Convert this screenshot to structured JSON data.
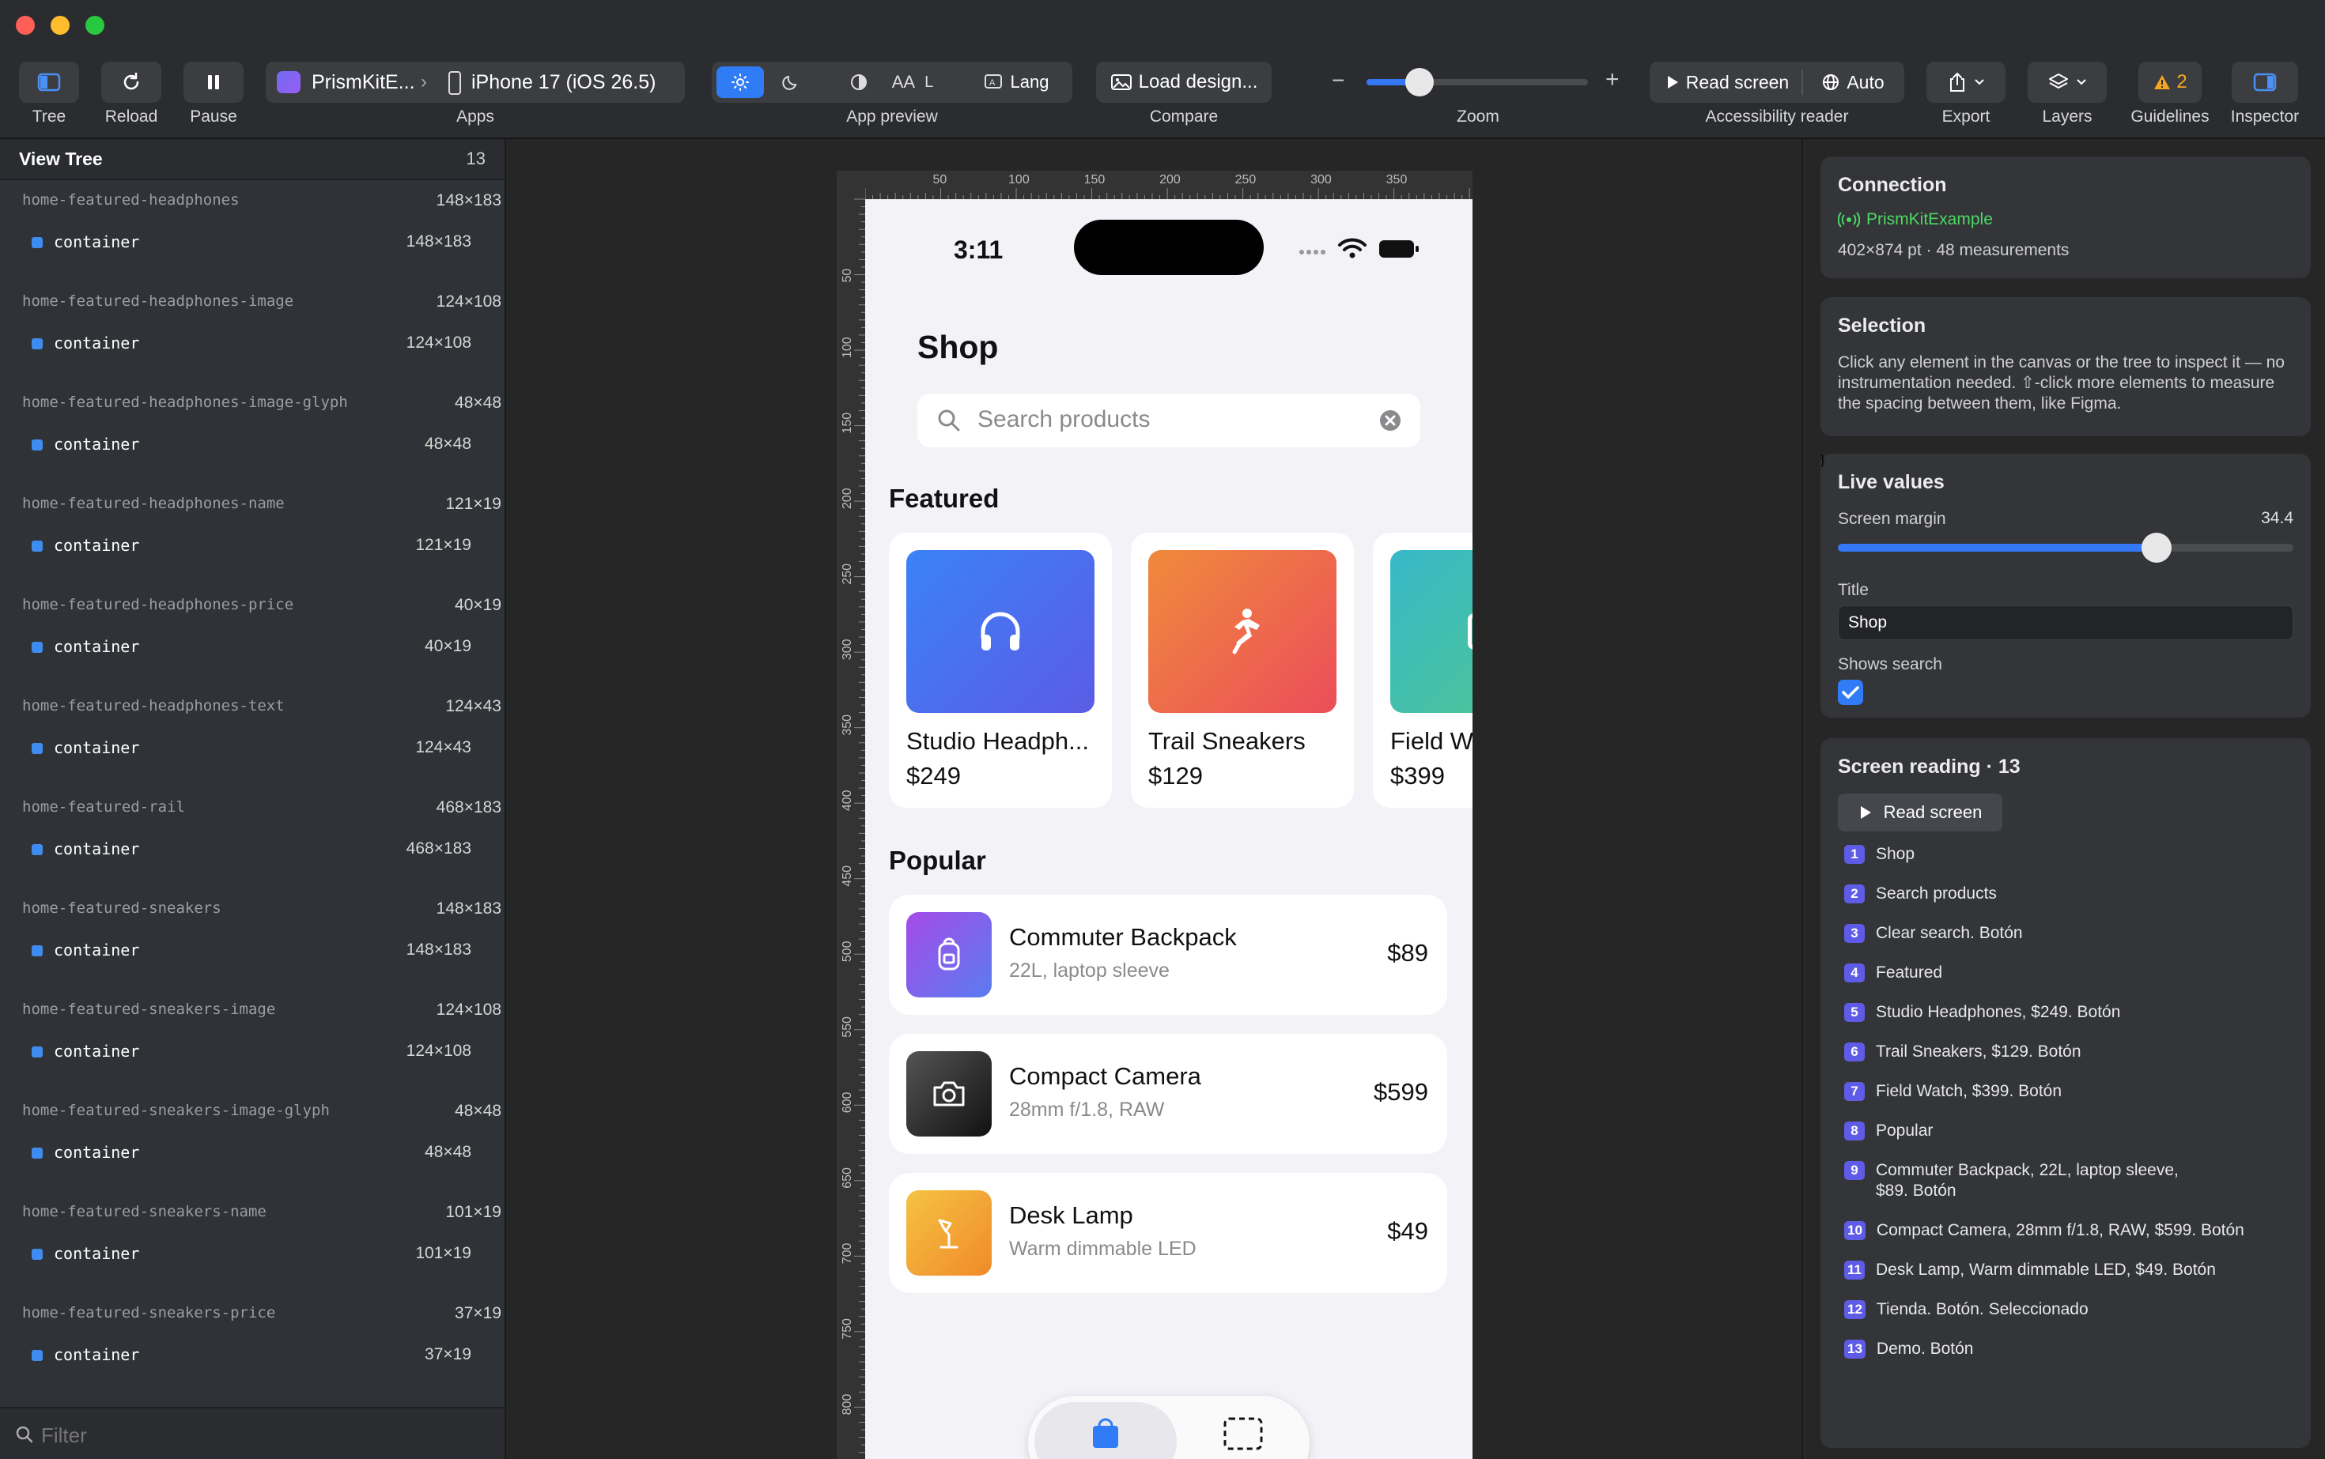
{
  "toolbar": {
    "tree": "Tree",
    "reload": "Reload",
    "pause": "Pause",
    "app_name": "PrismKitE...",
    "device": "iPhone 17 (iOS 26.5)",
    "apps": "Apps",
    "text_size": "AA",
    "text_size_level": "L",
    "lang": "Lang",
    "app_preview": "App preview",
    "load_design": "Load design...",
    "compare": "Compare",
    "zoom_minus": "−",
    "zoom_plus": "+",
    "zoom": "Zoom",
    "zoom_level": 0.24,
    "read_screen": "Read screen",
    "auto": "Auto",
    "accessibility_reader": "Accessibility reader",
    "export": "Export",
    "layers": "Layers",
    "guidelines_count": "2",
    "guidelines": "Guidelines",
    "inspector": "Inspector"
  },
  "view_tree": {
    "title": "View Tree",
    "count": "13",
    "filter_placeholder": "Filter",
    "items": [
      {
        "name": "home-featured-headphones",
        "size": "148×183",
        "kind": "container",
        "kind_size": "148×183"
      },
      {
        "name": "home-featured-headphones-image",
        "size": "124×108",
        "kind": "container",
        "kind_size": "124×108"
      },
      {
        "name": "home-featured-headphones-image-glyph",
        "size": "48×48",
        "kind": "container",
        "kind_size": "48×48"
      },
      {
        "name": "home-featured-headphones-name",
        "size": "121×19",
        "kind": "container",
        "kind_size": "121×19"
      },
      {
        "name": "home-featured-headphones-price",
        "size": "40×19",
        "kind": "container",
        "kind_size": "40×19"
      },
      {
        "name": "home-featured-headphones-text",
        "size": "124×43",
        "kind": "container",
        "kind_size": "124×43"
      },
      {
        "name": "home-featured-rail",
        "size": "468×183",
        "kind": "container",
        "kind_size": "468×183"
      },
      {
        "name": "home-featured-sneakers",
        "size": "148×183",
        "kind": "container",
        "kind_size": "148×183"
      },
      {
        "name": "home-featured-sneakers-image",
        "size": "124×108",
        "kind": "container",
        "kind_size": "124×108"
      },
      {
        "name": "home-featured-sneakers-image-glyph",
        "size": "48×48",
        "kind": "container",
        "kind_size": "48×48"
      },
      {
        "name": "home-featured-sneakers-name",
        "size": "101×19",
        "kind": "container",
        "kind_size": "101×19"
      },
      {
        "name": "home-featured-sneakers-price",
        "size": "37×19",
        "kind": "container",
        "kind_size": "37×19"
      }
    ]
  },
  "ruler": {
    "top": [
      "50",
      "100",
      "150",
      "200",
      "250",
      "300",
      "350"
    ],
    "left": [
      "50",
      "100",
      "150",
      "200",
      "250",
      "300",
      "350",
      "400",
      "450",
      "500",
      "550",
      "600",
      "650",
      "700",
      "750",
      "800"
    ]
  },
  "phone": {
    "time": "3:11",
    "title": "Shop",
    "search_placeholder": "Search products",
    "featured_heading": "Featured",
    "featured": [
      {
        "name": "Studio Headph...",
        "price": "$249",
        "color_from": "#3b82f6",
        "color_to": "#5b5ce6"
      },
      {
        "name": "Trail Sneakers",
        "price": "$129",
        "color_from": "#f08a3c",
        "color_to": "#ec4d5a"
      },
      {
        "name": "Field W",
        "price": "$399",
        "color_from": "#37b8c8",
        "color_to": "#52c88c"
      }
    ],
    "popular_heading": "Popular",
    "popular": [
      {
        "name": "Commuter Backpack",
        "subtitle": "22L, laptop sleeve",
        "price": "$89"
      },
      {
        "name": "Compact Camera",
        "subtitle": "28mm f/1.8, RAW",
        "price": "$599"
      },
      {
        "name": "Desk Lamp",
        "subtitle": "Warm dimmable LED",
        "price": "$49"
      }
    ]
  },
  "inspector": {
    "connection_title": "Connection",
    "connection_app": "PrismKitExample",
    "connection_info": "402×874 pt · 48 measurements",
    "selection_title": "Selection",
    "selection_text": "Click any element in the canvas or the tree to inspect it — no instrumentation needed. ⇧-click more elements to measure the spacing between them, like Figma.",
    "live_values_title": "Live values",
    "screen_margin_label": "Screen margin",
    "screen_margin_value": "34.4",
    "screen_margin_fraction": 0.7,
    "title_label": "Title",
    "title_value": "Shop",
    "shows_search_label": "Shows search",
    "shows_search_checked": true,
    "screen_reading_title": "Screen reading · 13",
    "read_screen_button": "Read screen",
    "readings": [
      {
        "n": "1",
        "text": "Shop"
      },
      {
        "n": "2",
        "text": "Search products"
      },
      {
        "n": "3",
        "text": "Clear search. Botón"
      },
      {
        "n": "4",
        "text": "Featured"
      },
      {
        "n": "5",
        "text": "Studio Headphones, $249. Botón"
      },
      {
        "n": "6",
        "text": "Trail Sneakers, $129. Botón"
      },
      {
        "n": "7",
        "text": "Field Watch, $399. Botón"
      },
      {
        "n": "8",
        "text": "Popular"
      },
      {
        "n": "9",
        "text": "Commuter Backpack, 22L, laptop sleeve,",
        "text2": "$89. Botón"
      },
      {
        "n": "10",
        "text": "Compact Camera, 28mm f/1.8, RAW, $599. Botón"
      },
      {
        "n": "11",
        "text": "Desk Lamp, Warm dimmable LED, $49. Botón"
      },
      {
        "n": "12",
        "text": "Tienda. Botón. Seleccionado"
      },
      {
        "n": "13",
        "text": "Demo. Botón"
      }
    ]
  },
  "colors": {
    "accent": "#3478f6",
    "badge": "#5e5ce6",
    "connected": "#4cd964",
    "warning": "#f5a623"
  }
}
